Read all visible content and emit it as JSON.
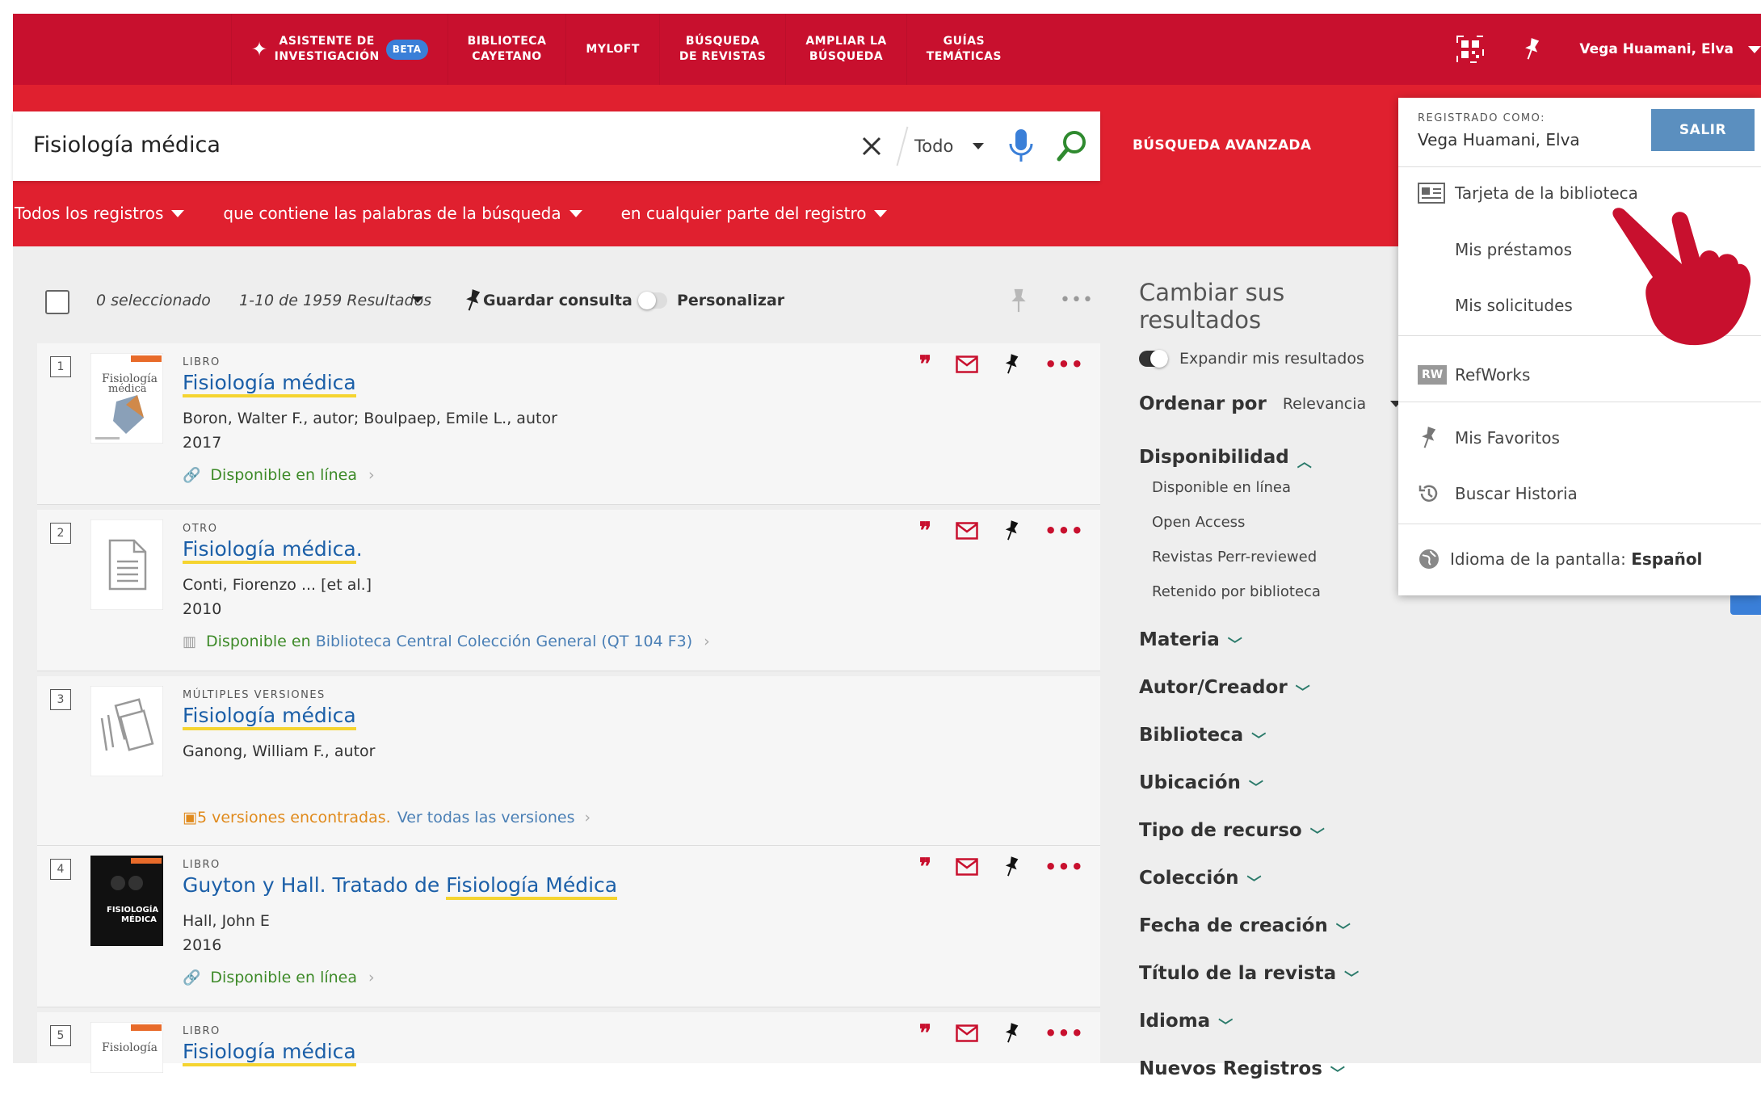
{
  "topnav": [
    {
      "label": "ASISTENTE DE\nINVESTIGACIÓN",
      "badge": "BETA",
      "icon": "sparkle-icon"
    },
    {
      "label": "BIBLIOTECA\nCAYETANO"
    },
    {
      "label": "MYLOFT"
    },
    {
      "label": "BÚSQUEDA\nDE REVISTAS"
    },
    {
      "label": "AMPLIAR LA\nBÚSQUEDA"
    },
    {
      "label": "GUÍAS\nTEMÁTICAS"
    }
  ],
  "user": {
    "name": "Vega Huamani, Elva"
  },
  "search": {
    "value": "Fisiología médica",
    "scope": "Todo",
    "advanced": "BÚSQUEDA AVANZADA"
  },
  "filters": [
    "Todos los registros",
    "que contiene las palabras de la búsqueda",
    "en cualquier parte del registro"
  ],
  "toolbar": {
    "selected": "0 seleccionado",
    "range": "1-10 de 1959 Resultados",
    "save_query": "Guardar consulta",
    "personalize": "Personalizar"
  },
  "results": [
    {
      "num": "1",
      "type": "LIBRO",
      "title": "Fisiología médica",
      "title_hl": "Fisiología médica",
      "title_pre": "",
      "title_post": "",
      "author": "Boron, Walter F., autor; Boulpaep, Emile L., autor",
      "year": "2017",
      "avail": "Disponible en línea"
    },
    {
      "num": "2",
      "type": "OTRO",
      "title_hl": "Fisiología médica",
      "title_post": ".",
      "author": "Conti, Fiorenzo ... [et al.]",
      "year": "2010",
      "avail": "Disponible en",
      "library": "Biblioteca Central  Colección General (QT 104 F3)"
    },
    {
      "num": "3",
      "type": "MÚLTIPLES VERSIONES",
      "title_hl": "Fisiología médica",
      "author": "Ganong, William F., autor",
      "versions": "5 versiones encontradas.",
      "versions_link": "Ver todas las versiones"
    },
    {
      "num": "4",
      "type": "LIBRO",
      "title_pre": "Guyton y Hall. Tratado de ",
      "title_hl": "Fisiología Médica",
      "author": "Hall, John E",
      "year": "2016",
      "avail": "Disponible en línea"
    },
    {
      "num": "5",
      "type": "LIBRO",
      "title_hl": "Fisiología médica"
    }
  ],
  "facets": {
    "heading": "Cambiar sus resultados",
    "expand": "Expandir mis resultados",
    "sort_label": "Ordenar por",
    "sort_value": "Relevancia",
    "availability": "Disponibilidad",
    "availability_options": [
      "Disponible en línea",
      "Open Access",
      "Revistas Perr-reviewed",
      "Retenido por biblioteca"
    ],
    "groups": [
      "Materia",
      "Autor/Creador",
      "Biblioteca",
      "Ubicación",
      "Tipo de recurso",
      "Colección",
      "Fecha de creación",
      "Título de la revista",
      "Idioma",
      "Nuevos Registros"
    ]
  },
  "user_menu": {
    "registered_as": "REGISTRADO COMO:",
    "user": "Vega Huamani, Elva",
    "logout": "SALIR",
    "items": [
      "Tarjeta de la biblioteca",
      "Mis préstamos",
      "Mis solicitudes",
      "RefWorks",
      "Mis Favoritos",
      "Buscar Historia"
    ],
    "refworks_badge": "RW",
    "language_label": "Idioma de la pantalla:",
    "language_value": "Español"
  },
  "colors": {
    "brand_red": "#c8102e",
    "link_blue": "#1b5fa8",
    "available_green": "#3d8a28",
    "highlight": "#f5d430"
  }
}
